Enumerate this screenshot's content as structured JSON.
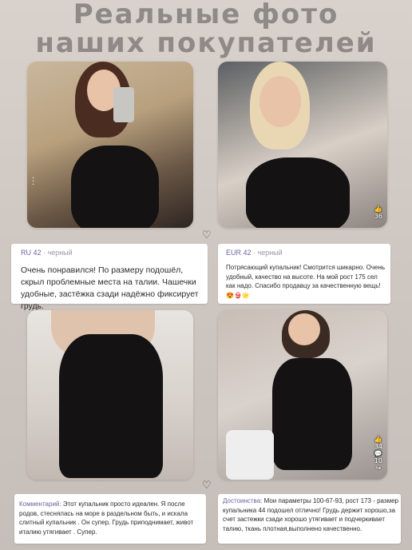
{
  "header": {
    "line1": "Реальные фото",
    "line2": "наших покупателей"
  },
  "reviews": [
    {
      "size": "RU 42",
      "color": " · черный",
      "text": "Очень понравился! По размеру подошёл, скрыл проблемные места на талии. Чашечки удобные, застёжка сзади надёжно фиксирует грудь."
    },
    {
      "size": "EUR 42",
      "color": " · черный",
      "text": "Потрясающий купальник! Смотрится шикарно. Очень удобный, качество на высоте. На мой рост 175 сел как надо. Спасибо продавцу за качественную вещь! 😍👙🌟"
    },
    {
      "label": "Комментарий:",
      "text": " Этот купальник просто идеален. Я после родов, стеснялась на море в раздельном быть, и искала слитный купальник . Он супер. Грудь приподнимает, живот италию утягивает . Супер."
    },
    {
      "label": "Достоинства:",
      "text": " Мои параметры 100-67-93, рост 173 - размер купальника 44 подошел отлично! Грудь держит хорошо,за счет застежки сзади хорошо утягивает и подчеркивает талию, ткань плотная,выполнено качественно."
    }
  ],
  "photo_icons": {
    "p2_like_count": "36",
    "p4_like_count": "34",
    "p4_comment_count": "10"
  },
  "colors": {
    "accent": "#6b65a0",
    "title": "#8f8a87",
    "background": "#d9d2cc"
  },
  "icons": [
    "heart-icon",
    "like-icon",
    "comment-icon",
    "share-icon",
    "more-dots-icon"
  ]
}
